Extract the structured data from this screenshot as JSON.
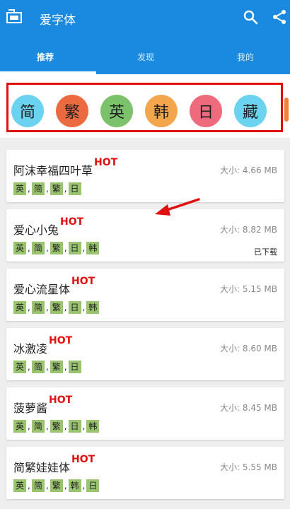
{
  "app": {
    "title": "爱字体"
  },
  "tabs": [
    {
      "label": "推荐"
    },
    {
      "label": "发现"
    },
    {
      "label": "我的"
    }
  ],
  "chips": [
    {
      "label": "简",
      "color": "#6bd3f0"
    },
    {
      "label": "繁",
      "color": "#ec6a3f"
    },
    {
      "label": "英",
      "color": "#7cc26a"
    },
    {
      "label": "韩",
      "color": "#f3a64b"
    },
    {
      "label": "日",
      "color": "#ee6a7d"
    },
    {
      "label": "藏",
      "color": "#6bd3f0"
    }
  ],
  "fonts": [
    {
      "name": "阿沫幸福四叶草",
      "hot": "HOT",
      "size": "大小: 4.66 MB",
      "tags": [
        "英",
        "简",
        "繁",
        "日"
      ],
      "status": ""
    },
    {
      "name": "爱心小兔",
      "hot": "HOT",
      "size": "大小: 8.82 MB",
      "tags": [
        "英",
        "简",
        "繁",
        "日",
        "韩"
      ],
      "status": "已下载"
    },
    {
      "name": "爱心流星体",
      "hot": "HOT",
      "size": "大小: 5.15 MB",
      "tags": [
        "英",
        "简",
        "繁",
        "日",
        "韩"
      ],
      "status": ""
    },
    {
      "name": "冰激凌",
      "hot": "HOT",
      "size": "大小: 8.60 MB",
      "tags": [
        "英",
        "简",
        "繁",
        "日"
      ],
      "status": ""
    },
    {
      "name": "菠萝酱",
      "hot": "HOT",
      "size": "大小: 8.45 MB",
      "tags": [
        "英",
        "简",
        "繁",
        "日",
        "韩"
      ],
      "status": ""
    },
    {
      "name": "简繁娃娃体",
      "hot": "HOT",
      "size": "大小: 5.55 MB",
      "tags": [
        "英",
        "简",
        "繁",
        "韩",
        "日"
      ],
      "status": ""
    }
  ],
  "colors": {
    "appbar": "#1a8ae0",
    "highlight": "#e01010",
    "tag": "#9bc46f"
  }
}
